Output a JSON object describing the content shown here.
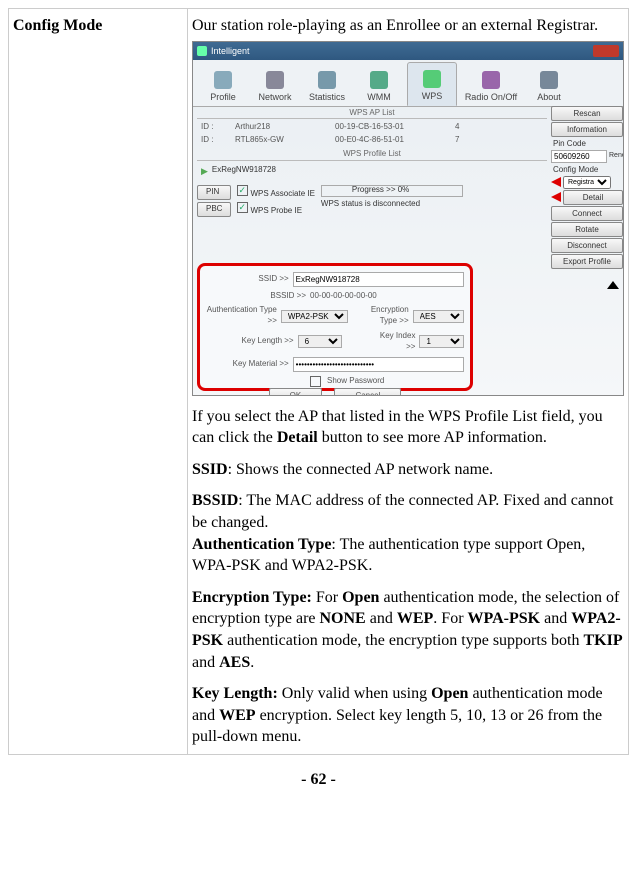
{
  "leftHeader": "Config Mode",
  "intro": "Our station role-playing as an Enrollee or an external Registrar.",
  "screenshot": {
    "title": "Intelligent",
    "tabs": [
      "Profile",
      "Network",
      "Statistics",
      "WMM",
      "WPS",
      "Radio On/Off",
      "About"
    ],
    "activeTab": "WPS",
    "side": {
      "rescan": "Rescan",
      "information": "Information",
      "pincodeLabel": "Pin Code",
      "pincodeValue": "50609260",
      "renew": "Renew",
      "configModeLabel": "Config Mode",
      "configModeValue": "Registrar",
      "pin": "PIN",
      "wpsAssoc": "WPS Associate IE",
      "pbc": "PBC",
      "wpsProbe": "WPS Probe IE",
      "detail": "Detail",
      "connect": "Connect",
      "rotate": "Rotate",
      "disconnect": "Disconnect",
      "export": "Export Profile"
    },
    "wpsApListTitle": "WPS AP List",
    "apRows": [
      {
        "c0": "ID :",
        "c1": "Arthur218",
        "c2": "00-19-CB-16-53-01",
        "c3": "4"
      },
      {
        "c0": "ID :",
        "c1": "RTL865x-GW",
        "c2": "00-E0-4C-86-51-01",
        "c3": "7"
      }
    ],
    "wpsProfileListTitle": "WPS Profile List",
    "profileItem": "ExRegNW918728",
    "progress": "Progress >> 0%",
    "status": "WPS status is disconnected",
    "form": {
      "ssidLabel": "SSID >>",
      "ssidValue": "ExRegNW918728",
      "bssidLabel": "BSSID >>",
      "bssidValue": "00-00-00-00-00-00",
      "authLabel": "Authentication Type >>",
      "authValue": "WPA2-PSK",
      "encLabel": "Encryption Type >>",
      "encValue": "AES",
      "keylenLabel": "Key Length >>",
      "keylenValue": "6",
      "keyidxLabel": "Key Index >>",
      "keyidxValue": "1",
      "keymatLabel": "Key Material >>",
      "keymatValue": "••••••••••••••••••••••••••••",
      "showpw": "Show Password",
      "ok": "OK",
      "cancel": "Cancel"
    }
  },
  "afterImg1a": "If you select the AP that listed in the WPS Profile List field, you can click the ",
  "afterImg1bold": "Detail",
  "afterImg1b": " button to see more AP information.",
  "ssidLine_b": "SSID",
  "ssidLine_t": ": Shows the connected AP network name.",
  "bssidLine_b": "BSSID",
  "bssidLine_t": ": The MAC address of the connected AP. Fixed and cannot be changed.",
  "authLine_b": "Authentication Type",
  "authLine_t": ": The authentication type support Open, WPA-PSK and WPA2-PSK.",
  "enc": {
    "b1": "Encryption Type:",
    "t1": " For ",
    "b2": "Open",
    "t2": " authentication mode, the selection of encryption type are ",
    "b3": "NONE",
    "t3": " and ",
    "b4": "WEP",
    "t4": ". For ",
    "b5": "WPA-PSK",
    "t5": " and ",
    "b6": "WPA2-PSK",
    "t6": " authentication mode, the encryption type supports both ",
    "b7": "TKIP",
    "t7": " and ",
    "b8": "AES",
    "t8": "."
  },
  "keylen": {
    "b1": "Key Length:",
    "t1": " Only valid when using ",
    "b2": "Open",
    "t2": " authentication mode and ",
    "b3": "WEP",
    "t3": " encryption. Select key length 5, 10, 13 or 26 from the pull-down menu."
  },
  "pageNum": "- 62 -"
}
